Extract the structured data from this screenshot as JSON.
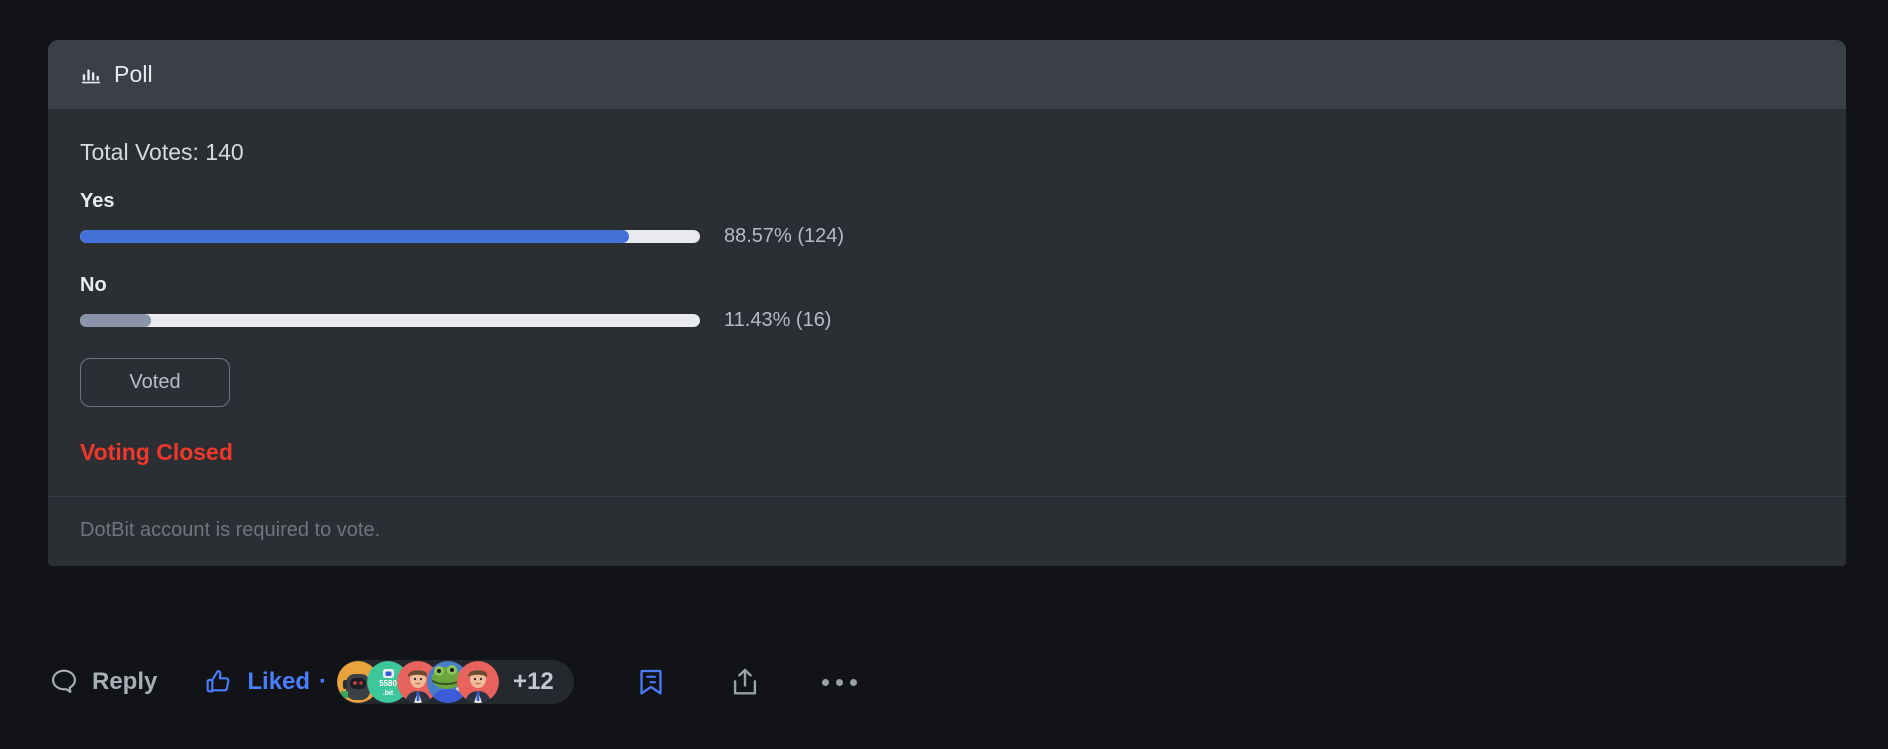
{
  "poll": {
    "header": {
      "icon": "poll-bar-chart-icon",
      "title": "Poll"
    },
    "total_votes_text": "Total Votes: 140",
    "total_votes": 140,
    "options": [
      {
        "label": "Yes",
        "percent": 88.57,
        "votes": 124,
        "value_text": "88.57% (124)",
        "fill_color": "#4272d8"
      },
      {
        "label": "No",
        "percent": 11.43,
        "votes": 16,
        "value_text": "11.43% (16)",
        "fill_color": "#8b93ab"
      }
    ],
    "vote_button_label": "Voted",
    "status_text": "Voting Closed",
    "status_color": "#f0372a",
    "footer_note": "DotBit account is required to vote."
  },
  "actions": {
    "reply": {
      "icon": "comment-bubble-icon",
      "label": "Reply"
    },
    "like": {
      "icon": "thumbs-up-icon",
      "label": "Liked",
      "separator": "·",
      "active_color": "#4a7dfd"
    },
    "likers": {
      "extra_count_label": "+12",
      "avatars": [
        {
          "name": "astronaut-avatar",
          "bg": "#e8a33d"
        },
        {
          "name": "dotbit-card-avatar",
          "bg": "#3ec79b",
          "text_top": "5580",
          "text_bottom": ".bit"
        },
        {
          "name": "person-avatar-1",
          "bg": "#e8625e"
        },
        {
          "name": "frog-avatar",
          "bg": "#4a7dc8"
        },
        {
          "name": "person-avatar-2",
          "bg": "#e8625e"
        }
      ]
    },
    "bookmark": {
      "icon": "bookmark-icon",
      "color": "#4a7dfd"
    },
    "share": {
      "icon": "share-upload-icon",
      "color": "#9aa0a8"
    },
    "more": {
      "icon": "more-horizontal-icon",
      "color": "#9aa0a8"
    }
  }
}
